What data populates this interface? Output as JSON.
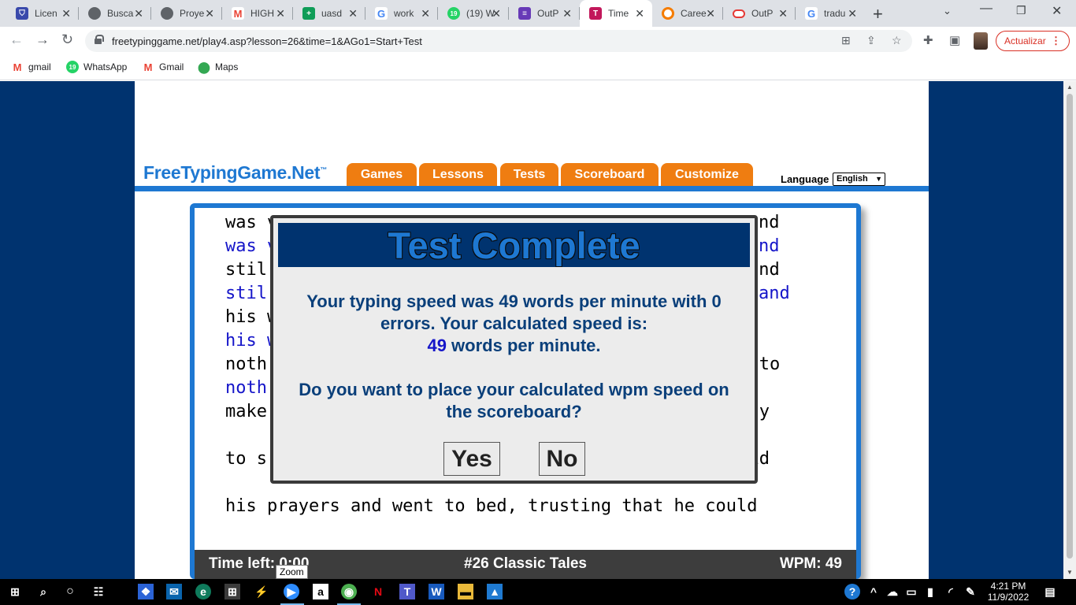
{
  "browser": {
    "tabs": [
      {
        "title": "Licen",
        "icon": "shield-icon",
        "color": "#3949ab"
      },
      {
        "title": "Busca",
        "icon": "globe-icon",
        "color": "#5f6368"
      },
      {
        "title": "Proye",
        "icon": "globe-icon",
        "color": "#5f6368"
      },
      {
        "title": "HIGH",
        "icon": "gmail-icon",
        "color": "#ea4335"
      },
      {
        "title": "uasd",
        "icon": "sheets-icon",
        "color": "#0f9d58"
      },
      {
        "title": "work",
        "icon": "google-icon",
        "color": "#4285f4"
      },
      {
        "title": "(19) W",
        "icon": "whatsapp-icon",
        "color": "#25d366"
      },
      {
        "title": "OutP",
        "icon": "forms-icon",
        "color": "#673ab7"
      },
      {
        "title": "Time",
        "icon": "t-icon",
        "color": "#c2185b"
      },
      {
        "title": "Caree",
        "icon": "ring-icon",
        "color": "#f57c00"
      },
      {
        "title": "OutP",
        "icon": "oracle-icon",
        "color": "#e53935"
      },
      {
        "title": "tradu",
        "icon": "google-icon",
        "color": "#4285f4"
      }
    ],
    "url": "freetypinggame.net/play4.asp?lesson=26&time=1&AGo1=Start+Test",
    "update_label": "Actualizar",
    "bookmarks": [
      {
        "label": "gmail",
        "icon": "gmail-icon"
      },
      {
        "label": "WhatsApp",
        "icon": "whatsapp-icon",
        "badge": "19"
      },
      {
        "label": "Gmail",
        "icon": "gmail-icon"
      },
      {
        "label": "Maps",
        "icon": "maps-icon"
      }
    ]
  },
  "site": {
    "logo": "FreeTypingGame.Net",
    "logo_tm": "™",
    "nav": [
      "Games",
      "Lessons",
      "Tests",
      "Scoreboard",
      "Customize"
    ],
    "language_label": "Language",
    "language_value": "English",
    "accent": "#ef7d11",
    "brand_blue": "#1e78d2"
  },
  "game": {
    "lines": [
      {
        "text": "was v",
        "right": "nd",
        "kind": "src"
      },
      {
        "text": "was v",
        "right": "nd",
        "kind": "typed"
      },
      {
        "text": "stil",
        "right": "and",
        "kind": "src"
      },
      {
        "text": "stil",
        "right": "and",
        "kind": "typed"
      },
      {
        "text": "his w",
        "right": "",
        "kind": "src"
      },
      {
        "text": "his w",
        "right": "",
        "kind": "typed"
      },
      {
        "text": "noth",
        "right": "gh to",
        "kind": "src"
      },
      {
        "text": "noth",
        "right": "",
        "kind": "typed"
      },
      {
        "text": "make",
        "right": "eady",
        "kind": "src"
      },
      {
        "text": "to s",
        "right": "said",
        "kind": "src"
      },
      {
        "text": "his prayers and went to bed, trusting that he could",
        "right": "",
        "kind": "src"
      }
    ],
    "status": {
      "time_left": "Time left: 0:00",
      "lesson": "#26 Classic Tales",
      "wpm": "WPM: 49"
    },
    "tooltip": "Zoom"
  },
  "modal": {
    "title": "Test Complete",
    "result_prefix": "Your typing speed was 49 words per minute with 0",
    "result_line2": "errors. Your calculated speed is:",
    "calculated_wpm": "49",
    "wpm_suffix": " words per minute.",
    "question_line1": "Do you want to place your calculated wpm speed on",
    "question_line2": "the scoreboard?",
    "yes_label": "Yes",
    "no_label": "No"
  },
  "taskbar": {
    "time": "4:21 PM",
    "date": "11/9/2022"
  }
}
